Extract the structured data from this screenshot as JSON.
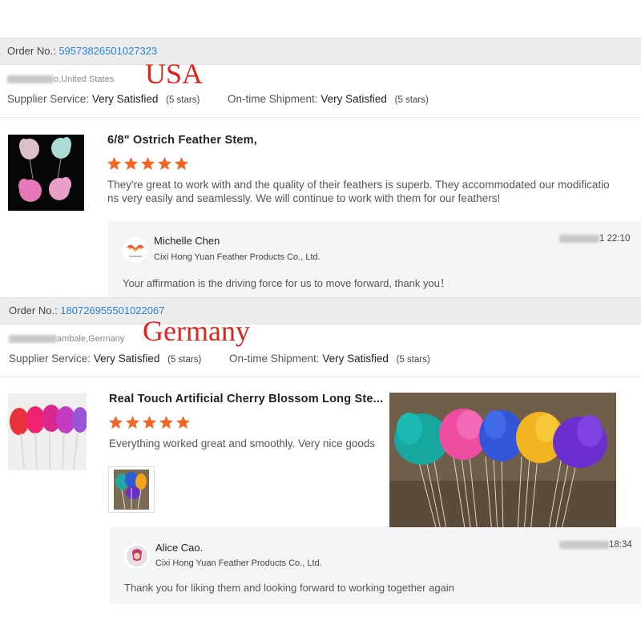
{
  "reviews": [
    {
      "order_label": "Order No.:",
      "order_number": "5957382650102732​3",
      "location": "o,United States",
      "country_annotation": "USA",
      "supplier_label": "Supplier Service:",
      "supplier_value": "Very Satisfied",
      "supplier_stars": "(5 stars)",
      "shipment_label": "On-time Shipment:",
      "shipment_value": "Very Satisfied",
      "shipment_stars": "(5 stars)",
      "product_title": "6/8\" Ostrich Feather Stem,",
      "rating": 5,
      "review_line1": "They're great to work with and the quality of their feathers is superb.  They accommodated our modificatio",
      "review_line2": "ns very easily and seamlessly.  We will continue to work with them for our feathers!",
      "reply_name": "Michelle Chen",
      "reply_company": "Cixi Hong Yuan Feather Products Co., Ltd.",
      "reply_time": "1 22:10",
      "reply_text": "Your affirmation is the driving force for us to move forward, thank you！"
    },
    {
      "order_label": "Order No.:",
      "order_number": "180726955501022067",
      "location": "ambale,Germany",
      "country_annotation": "Germany",
      "supplier_label": "Supplier Service:",
      "supplier_value": "Very Satisfied",
      "supplier_stars": "(5 stars)",
      "shipment_label": "On-time Shipment:",
      "shipment_value": "Very Satisfied",
      "shipment_stars": "(5 stars)",
      "product_title": "Real Touch Artificial Cherry Blossom Long Ste...",
      "rating": 5,
      "review_line1": "Everything worked great and smoothly. Very nice goods",
      "reply_name": "Alice Cao.",
      "reply_company": "Cixi Hong Yuan Feather Products Co., Ltd.",
      "reply_time": "18:34",
      "reply_text": "Thank you for liking them and looking forward to working together again"
    }
  ],
  "colors": {
    "star": "#f26522",
    "link": "#2a84d2",
    "annotation": "#e0231b"
  }
}
